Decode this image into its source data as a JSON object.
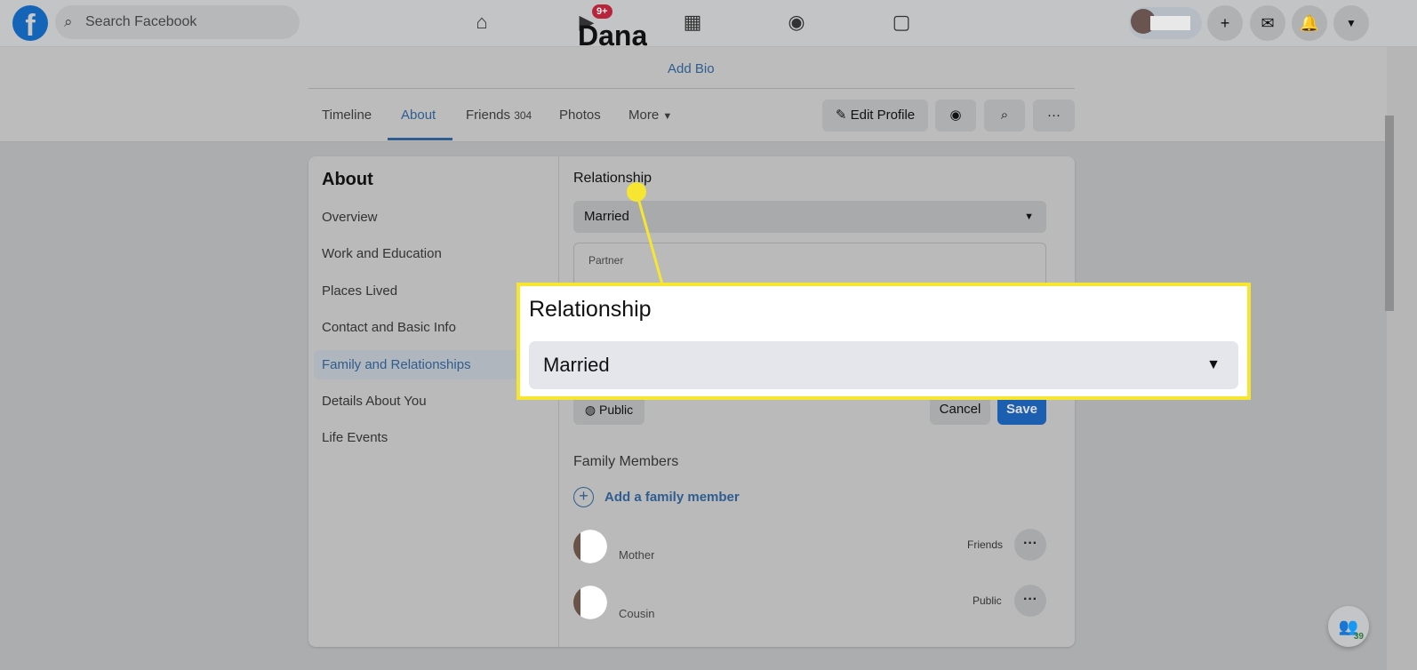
{
  "header": {
    "search_placeholder": "Search Facebook",
    "watch_badge": "9+",
    "user_name": "Dana"
  },
  "profile": {
    "name": "Dana",
    "add_bio": "Add Bio",
    "tabs": [
      {
        "label": "Timeline"
      },
      {
        "label": "About"
      },
      {
        "label": "Friends",
        "count": "304"
      },
      {
        "label": "Photos"
      },
      {
        "label": "More"
      }
    ],
    "edit_profile": "Edit Profile"
  },
  "about": {
    "title": "About",
    "items": [
      "Overview",
      "Work and Education",
      "Places Lived",
      "Contact and Basic Info",
      "Family and Relationships",
      "Details About You",
      "Life Events"
    ],
    "active": "Family and Relationships"
  },
  "relationship": {
    "label": "Relationship",
    "value": "Married",
    "partner_label": "Partner",
    "privacy": "Public",
    "cancel": "Cancel",
    "save": "Save"
  },
  "callout": {
    "label": "Relationship",
    "value": "Married",
    "border_color": "#f6e531"
  },
  "family": {
    "title": "Family Members",
    "add": "Add a family member",
    "members": [
      {
        "relation": "Mother",
        "privacy": "Friends"
      },
      {
        "relation": "Cousin",
        "privacy": "Public"
      }
    ]
  },
  "chat": {
    "online_count": "39"
  }
}
